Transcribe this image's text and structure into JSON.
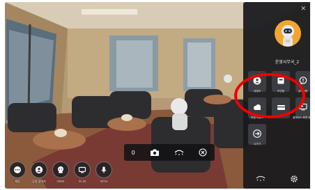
{
  "toolbar": {
    "items": [
      {
        "label": "채팅",
        "icon": "chat-icon"
      },
      {
        "label": "공명 참여자",
        "icon": "participants-icon"
      },
      {
        "label": "아바타",
        "icon": "avatar-icon"
      },
      {
        "label": "모니터",
        "icon": "monitor-icon"
      },
      {
        "label": "마이크",
        "icon": "microphone-icon"
      }
    ]
  },
  "camera_bar": {
    "count": "0"
  },
  "menu": {
    "username": "운영사무국_2",
    "tiles": [
      {
        "label": "내정보",
        "icon": "my-info-icon"
      },
      {
        "label": "보관함",
        "icon": "storage-icon"
      },
      {
        "label": "공지사항",
        "icon": "notice-icon"
      },
      {
        "label": "파일 저장소",
        "icon": "cloud-storage-icon"
      },
      {
        "label": "",
        "icon": "card-icon"
      },
      {
        "label": "플레이스 화면 공유",
        "icon": "screen-share-icon"
      },
      {
        "label": "나가기",
        "icon": "exit-icon"
      }
    ]
  },
  "colors": {
    "panel": "#1a1b1e",
    "tile": "#3c3d42",
    "avatar_bg": "#f2a531",
    "highlight": "#ef0000"
  }
}
